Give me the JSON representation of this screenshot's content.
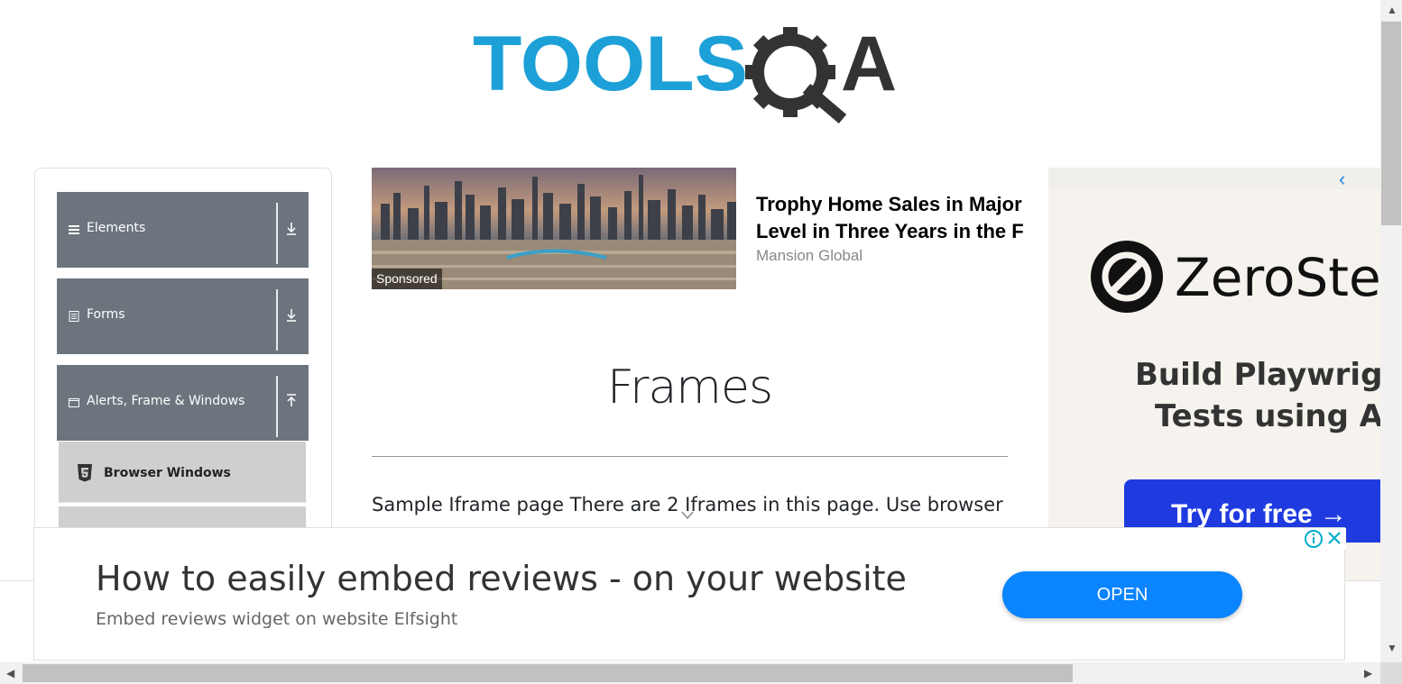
{
  "logo": {
    "text": "TOOLSQA",
    "part1": "TOOLS",
    "part2": "A",
    "colors": {
      "blue": "#1da0d8",
      "dark": "#333333"
    }
  },
  "sidebar": {
    "groups": [
      {
        "label": "Elements",
        "icon": "hamburger-icon",
        "arrow": "download-arrow-icon"
      },
      {
        "label": "Forms",
        "icon": "form-icon",
        "arrow": "download-arrow-icon"
      },
      {
        "label": "Alerts, Frame & Windows",
        "icon": "window-icon",
        "arrow": "upload-arrow-icon"
      }
    ],
    "items": [
      {
        "label": "Browser Windows",
        "icon": "html5-icon"
      }
    ]
  },
  "sponsored_ad": {
    "badge": "Sponsored",
    "headline": "Trophy Home Sales in Major Level in Three Years in the F",
    "source": "Mansion Global"
  },
  "main": {
    "title": "Frames",
    "intro": "Sample Iframe page There are 2 Iframes in this page. Use browser"
  },
  "side_ad": {
    "brand": "ZeroSte",
    "line1": "Build Playwrigh",
    "line2": "Tests using A",
    "cta": "Try for free →",
    "colors": {
      "cta_bg": "#1f3be0"
    }
  },
  "bottom_ad": {
    "headline": "How to easily embed reviews - on your website",
    "subline": "Embed reviews widget on website Elfsight",
    "open_label": "OPEN",
    "colors": {
      "button": "#0a84ff"
    }
  }
}
